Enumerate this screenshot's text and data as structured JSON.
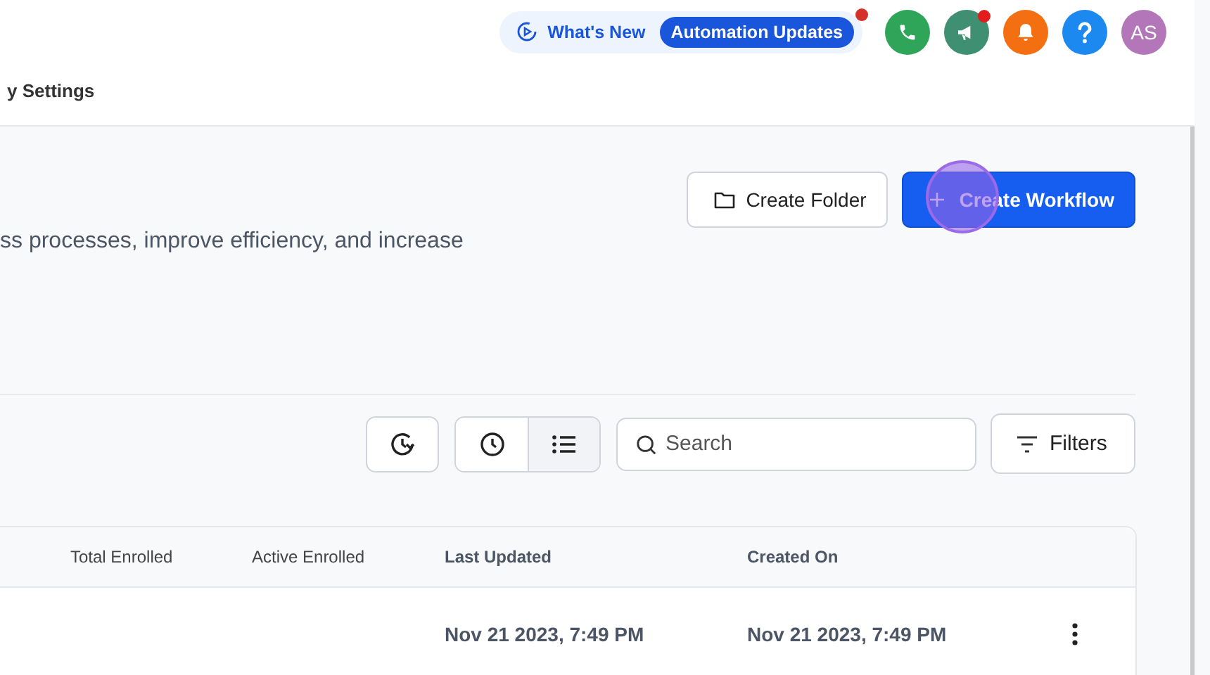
{
  "header": {
    "whats_new": "What's New",
    "badge": "Automation Updates",
    "badge_dot": true,
    "icons": [
      {
        "kind": "phone",
        "color": "#2fa55a",
        "dot": false
      },
      {
        "kind": "megaphone",
        "color": "#3f8f72",
        "dot": true
      },
      {
        "kind": "bell",
        "color": "#f36f12",
        "dot": false
      },
      {
        "kind": "help",
        "color": "#1c89f0",
        "dot": false
      }
    ],
    "avatar": "AS",
    "nav_label": "y Settings"
  },
  "page": {
    "description": "ss processes, improve efficiency, and increase",
    "create_folder": "Create Folder",
    "create_workflow": "Create Workflow"
  },
  "toolbar": {
    "views": [
      {
        "kind": "clock",
        "selected": false
      },
      {
        "kind": "list",
        "selected": true
      }
    ],
    "search": {
      "placeholder": "Search"
    },
    "filters": "Filters"
  },
  "table": {
    "columns": [
      "Total Enrolled",
      "Active Enrolled",
      "Last Updated",
      "Created On"
    ],
    "rows": [
      {
        "cells": [
          "",
          "",
          "Nov 21 2023, 7:49 PM",
          "Nov 21 2023, 7:49 PM"
        ]
      }
    ]
  }
}
